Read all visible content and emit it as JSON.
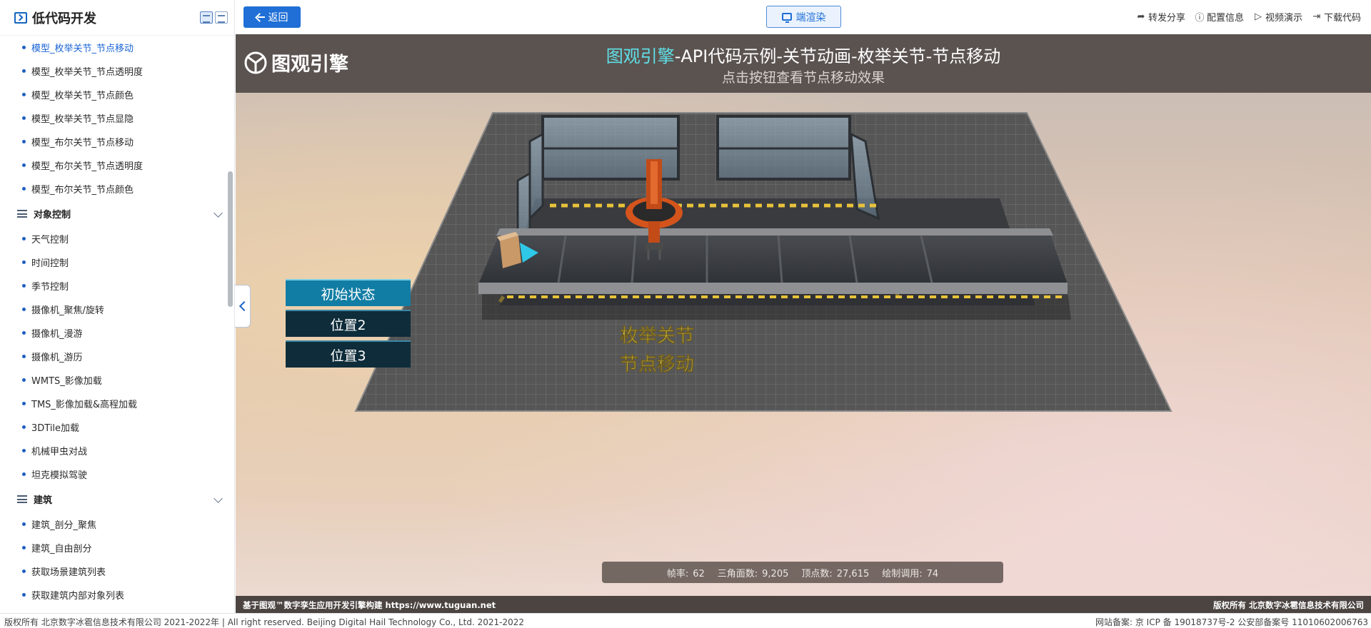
{
  "sidebar": {
    "title": "低代码开发",
    "items_top": [
      {
        "label": "模型_枚举关节_节点移动",
        "active": true
      },
      {
        "label": "模型_枚举关节_节点透明度"
      },
      {
        "label": "模型_枚举关节_节点颜色"
      },
      {
        "label": "模型_枚举关节_节点显隐"
      },
      {
        "label": "模型_布尔关节_节点移动"
      },
      {
        "label": "模型_布尔关节_节点透明度"
      },
      {
        "label": "模型_布尔关节_节点颜色"
      }
    ],
    "group_object_control": {
      "label": "对象控制",
      "items": [
        "天气控制",
        "时间控制",
        "季节控制",
        "摄像机_聚焦/旋转",
        "摄像机_漫游",
        "摄像机_游历",
        "WMTS_影像加载",
        "TMS_影像加载&高程加载",
        "3DTile加载",
        "机械甲虫对战",
        "坦克模拟驾驶"
      ]
    },
    "group_building": {
      "label": "建筑",
      "items": [
        "建筑_剖分_聚焦",
        "建筑_自由剖分",
        "获取场景建筑列表",
        "获取建筑内部对象列表"
      ]
    }
  },
  "toolbar": {
    "back_label": "返回",
    "render_label": "端渲染",
    "links": [
      {
        "icon": "share-icon",
        "glyph": "➦",
        "label": "转发分享"
      },
      {
        "icon": "info-icon",
        "glyph": "ⓘ",
        "label": "配置信息"
      },
      {
        "icon": "play-icon",
        "glyph": "▷",
        "label": "视频演示"
      },
      {
        "icon": "download-icon",
        "glyph": "⇥",
        "label": "下载代码"
      }
    ]
  },
  "viewport": {
    "logo_text": "图观引擎",
    "title_accent": "图观引擎",
    "title_rest": "-API代码示例-关节动画-枚举关节-节点移动",
    "subtitle": "点击按钮查看节点移动效果",
    "scene_label_line1": "枚举关节",
    "scene_label_line2": "节点移动",
    "position_buttons": [
      {
        "label": "初始状态",
        "active": true
      },
      {
        "label": "位置2"
      },
      {
        "label": "位置3"
      }
    ],
    "stats": {
      "fps_label": "帧率:",
      "fps": "62",
      "tris_label": "三角面数:",
      "tris": "9,205",
      "verts_label": "顶点数:",
      "verts": "27,615",
      "draws_label": "绘制调用:",
      "draws": "74"
    },
    "footer_left": "基于图观™数字孪生应用开发引擎构建 https://www.tuguan.net",
    "footer_right": "版权所有 北京数字冰雹信息技术有限公司"
  },
  "page_footer": {
    "left": "版权所有 北京数字冰雹信息技术有限公司 2021-2022年 | All right reserved. Beijing Digital Hail Technology Co., Ltd. 2021-2022",
    "right": "网站备案: 京 ICP 备 19018737号-2 公安部备案号 11010602006763"
  },
  "colors": {
    "accent_blue": "#1f6fd6",
    "title_accent": "#5fe0e8",
    "scene_label": "#f4e04a",
    "active_pos_button": "#127da4"
  }
}
